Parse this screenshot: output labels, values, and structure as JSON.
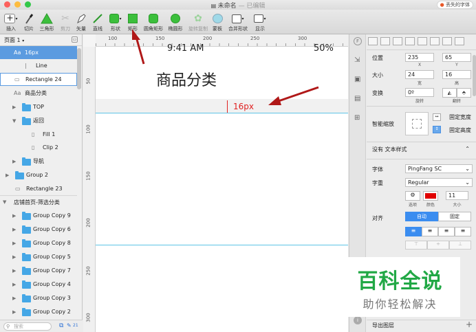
{
  "window": {
    "title": "未命名",
    "subtitle": "— 已编辑",
    "lost_fonts": "丢失的字体"
  },
  "toolbar": [
    {
      "name": "insert",
      "label": "插入",
      "icon": "plus-icon"
    },
    {
      "name": "slice",
      "label": "切片",
      "icon": "knife-icon"
    },
    {
      "name": "triangle",
      "label": "三角形",
      "icon": "triangle-icon"
    },
    {
      "name": "scissors",
      "label": "剪刀",
      "icon": "scissors-icon"
    },
    {
      "name": "vector",
      "label": "矢量",
      "icon": "pen-icon"
    },
    {
      "name": "line",
      "label": "直线",
      "icon": "line-icon"
    },
    {
      "name": "shape",
      "label": "形状",
      "icon": "shape-grid-icon"
    },
    {
      "name": "rectangle",
      "label": "矩形",
      "icon": "rectangle-icon"
    },
    {
      "name": "rounded_rectangle",
      "label": "圆角矩形",
      "icon": "rounded-rect-icon"
    },
    {
      "name": "oval",
      "label": "椭圆形",
      "icon": "oval-icon"
    },
    {
      "name": "rotate_copy",
      "label": "旋转复制",
      "icon": "gear-icon"
    },
    {
      "name": "mask",
      "label": "蒙板",
      "icon": "mask-icon"
    },
    {
      "name": "combine",
      "label": "合并形状",
      "icon": "combine-icon"
    },
    {
      "name": "display",
      "label": "显示",
      "icon": "display-icon"
    }
  ],
  "sidebar": {
    "page": "页面 1",
    "layers": [
      {
        "label": "16px",
        "type": "text"
      },
      {
        "label": "Line",
        "type": "line"
      },
      {
        "label": "Rectangle 24",
        "type": "rect"
      },
      {
        "label": "商品分类",
        "type": "text"
      },
      {
        "label": "TOP",
        "type": "folder"
      },
      {
        "label": "返回",
        "type": "folder"
      },
      {
        "label": "Fill 1",
        "type": "path"
      },
      {
        "label": "Clip 2",
        "type": "path"
      },
      {
        "label": "导航",
        "type": "folder"
      },
      {
        "label": "Group 2",
        "type": "folder"
      },
      {
        "label": "Rectangle 23",
        "type": "rect"
      },
      {
        "label": "店铺首页-筛选分类",
        "type": "artboard"
      },
      {
        "label": "Group Copy 9",
        "type": "folder"
      },
      {
        "label": "Group Copy 6",
        "type": "folder"
      },
      {
        "label": "Group Copy 8",
        "type": "folder"
      },
      {
        "label": "Group Copy 5",
        "type": "folder"
      },
      {
        "label": "Group Copy 7",
        "type": "folder"
      },
      {
        "label": "Group Copy 4",
        "type": "folder"
      },
      {
        "label": "Group Copy 3",
        "type": "folder"
      },
      {
        "label": "Group Copy 2",
        "type": "folder"
      }
    ],
    "search_placeholder": "搜索",
    "count": "21"
  },
  "canvas": {
    "ruler_h": [
      "100",
      "150",
      "200",
      "250",
      "300"
    ],
    "ruler_v": [
      "50",
      "100",
      "150",
      "200",
      "250",
      "300"
    ],
    "time": "9:41 AM",
    "battery": "50%",
    "heading": "商品分类",
    "measure": "16px"
  },
  "inspector": {
    "position_label": "位置",
    "x": "235",
    "x_cap": "X",
    "y": "65",
    "y_cap": "Y",
    "size_label": "大小",
    "w": "24",
    "w_cap": "宽",
    "h": "16",
    "h_cap": "高",
    "transform_label": "变换",
    "rotate": "0º",
    "rotate_cap": "旋转",
    "flip_cap": "翻转",
    "resize_label": "智能缩放",
    "fixed_width": "固定宽度",
    "fixed_height": "固定高度",
    "text_style": "没有 文本样式",
    "font_label": "字体",
    "font": "PingFang SC",
    "weight_label": "字重",
    "weight": "Regular",
    "options_cap": "选项",
    "color_cap": "颜色",
    "text_color": "#e00000",
    "size_value": "11",
    "size_cap": "大小",
    "align_label": "对齐",
    "auto": "自动",
    "fixed": "固定",
    "export": "导出图层"
  },
  "watermark": {
    "line1": "百科全说",
    "line2": "助你轻松解决"
  }
}
